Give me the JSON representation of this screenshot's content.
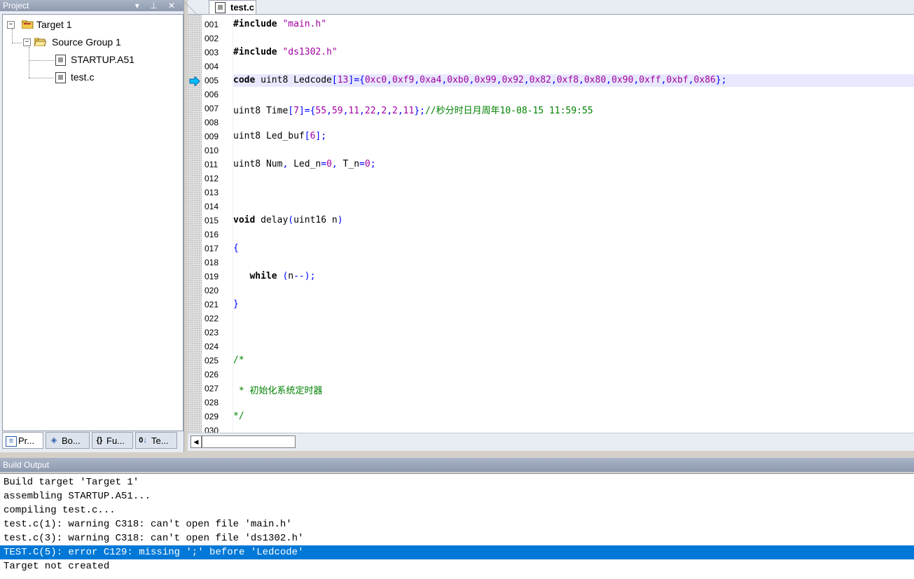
{
  "project": {
    "title": "Project",
    "title_buttons": "▾ ⊥ ✕",
    "tree": {
      "target": "Target 1",
      "group": "Source Group 1",
      "files": [
        "STARTUP.A51",
        "test.c"
      ]
    },
    "tabs": [
      "Pr...",
      "Bo...",
      "Fu...",
      "Te..."
    ],
    "tab_icons": [
      "project-icon",
      "books-icon",
      "functions-icon",
      "templates-icon"
    ]
  },
  "editor": {
    "tab_label": "test.c",
    "line_numbers": [
      "001",
      "002",
      "003",
      "004",
      "005",
      "006",
      "007",
      "008",
      "009",
      "010",
      "011",
      "012",
      "013",
      "014",
      "015",
      "016",
      "017",
      "018",
      "019",
      "020",
      "021",
      "022",
      "023",
      "024",
      "025",
      "026",
      "027",
      "028",
      "029",
      "030"
    ],
    "current_line": "005",
    "code": {
      "l001": "#include \"main.h\"",
      "l003": "#include \"ds1302.h\"",
      "l005": "code uint8 Ledcode[13]={0xc0,0xf9,0xa4,0xb0,0x99,0x92,0x82,0xf8,0x80,0x90,0xff,0xbf,0x86};",
      "l007": "uint8 Time[7]={55,59,11,22,2,2,11};//秒分时日月周年10-08-15 11:59:55",
      "l009": "uint8 Led_buf[6];",
      "l011": "uint8 Num, Led_n=0, T_n=0;",
      "l015": "void delay(uint16 n)",
      "l017": "{",
      "l019": "   while (n--);",
      "l021": "}",
      "l025": "/*",
      "l027": " * 初始化系统定时器",
      "l029": "*/"
    },
    "colors": {
      "keyword": "#000000",
      "string": "#a000a0",
      "comment": "#008000",
      "punct": "#0000ff",
      "highlight": "#e8e8ff"
    }
  },
  "build": {
    "title": "Build Output",
    "lines": [
      "Build target 'Target 1'",
      "assembling STARTUP.A51...",
      "compiling test.c...",
      "test.c(1): warning C318: can't open file 'main.h'",
      "test.c(3): warning C318: can't open file 'ds1302.h'",
      "TEST.C(5): error C129: missing ';' before 'Ledcode'",
      "Target not created"
    ],
    "selected_index": 5,
    "selection_color": "#0078d7"
  }
}
